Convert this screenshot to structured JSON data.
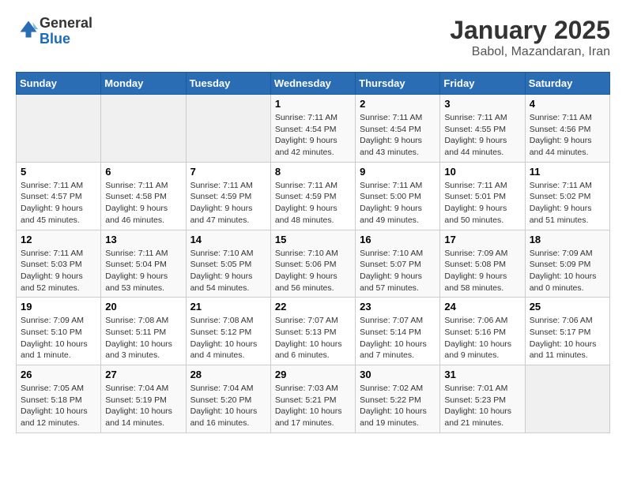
{
  "header": {
    "logo_line1": "General",
    "logo_line2": "Blue",
    "title": "January 2025",
    "subtitle": "Babol, Mazandaran, Iran"
  },
  "days_of_week": [
    "Sunday",
    "Monday",
    "Tuesday",
    "Wednesday",
    "Thursday",
    "Friday",
    "Saturday"
  ],
  "weeks": [
    [
      {
        "day": "",
        "empty": true
      },
      {
        "day": "",
        "empty": true
      },
      {
        "day": "",
        "empty": true
      },
      {
        "day": "1",
        "sunrise": "7:11 AM",
        "sunset": "4:54 PM",
        "daylight": "9 hours and 42 minutes."
      },
      {
        "day": "2",
        "sunrise": "7:11 AM",
        "sunset": "4:54 PM",
        "daylight": "9 hours and 43 minutes."
      },
      {
        "day": "3",
        "sunrise": "7:11 AM",
        "sunset": "4:55 PM",
        "daylight": "9 hours and 44 minutes."
      },
      {
        "day": "4",
        "sunrise": "7:11 AM",
        "sunset": "4:56 PM",
        "daylight": "9 hours and 44 minutes."
      }
    ],
    [
      {
        "day": "5",
        "sunrise": "7:11 AM",
        "sunset": "4:57 PM",
        "daylight": "9 hours and 45 minutes."
      },
      {
        "day": "6",
        "sunrise": "7:11 AM",
        "sunset": "4:58 PM",
        "daylight": "9 hours and 46 minutes."
      },
      {
        "day": "7",
        "sunrise": "7:11 AM",
        "sunset": "4:59 PM",
        "daylight": "9 hours and 47 minutes."
      },
      {
        "day": "8",
        "sunrise": "7:11 AM",
        "sunset": "4:59 PM",
        "daylight": "9 hours and 48 minutes."
      },
      {
        "day": "9",
        "sunrise": "7:11 AM",
        "sunset": "5:00 PM",
        "daylight": "9 hours and 49 minutes."
      },
      {
        "day": "10",
        "sunrise": "7:11 AM",
        "sunset": "5:01 PM",
        "daylight": "9 hours and 50 minutes."
      },
      {
        "day": "11",
        "sunrise": "7:11 AM",
        "sunset": "5:02 PM",
        "daylight": "9 hours and 51 minutes."
      }
    ],
    [
      {
        "day": "12",
        "sunrise": "7:11 AM",
        "sunset": "5:03 PM",
        "daylight": "9 hours and 52 minutes."
      },
      {
        "day": "13",
        "sunrise": "7:11 AM",
        "sunset": "5:04 PM",
        "daylight": "9 hours and 53 minutes."
      },
      {
        "day": "14",
        "sunrise": "7:10 AM",
        "sunset": "5:05 PM",
        "daylight": "9 hours and 54 minutes."
      },
      {
        "day": "15",
        "sunrise": "7:10 AM",
        "sunset": "5:06 PM",
        "daylight": "9 hours and 56 minutes."
      },
      {
        "day": "16",
        "sunrise": "7:10 AM",
        "sunset": "5:07 PM",
        "daylight": "9 hours and 57 minutes."
      },
      {
        "day": "17",
        "sunrise": "7:09 AM",
        "sunset": "5:08 PM",
        "daylight": "9 hours and 58 minutes."
      },
      {
        "day": "18",
        "sunrise": "7:09 AM",
        "sunset": "5:09 PM",
        "daylight": "10 hours and 0 minutes."
      }
    ],
    [
      {
        "day": "19",
        "sunrise": "7:09 AM",
        "sunset": "5:10 PM",
        "daylight": "10 hours and 1 minute."
      },
      {
        "day": "20",
        "sunrise": "7:08 AM",
        "sunset": "5:11 PM",
        "daylight": "10 hours and 3 minutes."
      },
      {
        "day": "21",
        "sunrise": "7:08 AM",
        "sunset": "5:12 PM",
        "daylight": "10 hours and 4 minutes."
      },
      {
        "day": "22",
        "sunrise": "7:07 AM",
        "sunset": "5:13 PM",
        "daylight": "10 hours and 6 minutes."
      },
      {
        "day": "23",
        "sunrise": "7:07 AM",
        "sunset": "5:14 PM",
        "daylight": "10 hours and 7 minutes."
      },
      {
        "day": "24",
        "sunrise": "7:06 AM",
        "sunset": "5:16 PM",
        "daylight": "10 hours and 9 minutes."
      },
      {
        "day": "25",
        "sunrise": "7:06 AM",
        "sunset": "5:17 PM",
        "daylight": "10 hours and 11 minutes."
      }
    ],
    [
      {
        "day": "26",
        "sunrise": "7:05 AM",
        "sunset": "5:18 PM",
        "daylight": "10 hours and 12 minutes."
      },
      {
        "day": "27",
        "sunrise": "7:04 AM",
        "sunset": "5:19 PM",
        "daylight": "10 hours and 14 minutes."
      },
      {
        "day": "28",
        "sunrise": "7:04 AM",
        "sunset": "5:20 PM",
        "daylight": "10 hours and 16 minutes."
      },
      {
        "day": "29",
        "sunrise": "7:03 AM",
        "sunset": "5:21 PM",
        "daylight": "10 hours and 17 minutes."
      },
      {
        "day": "30",
        "sunrise": "7:02 AM",
        "sunset": "5:22 PM",
        "daylight": "10 hours and 19 minutes."
      },
      {
        "day": "31",
        "sunrise": "7:01 AM",
        "sunset": "5:23 PM",
        "daylight": "10 hours and 21 minutes."
      },
      {
        "day": "",
        "empty": true
      }
    ]
  ]
}
